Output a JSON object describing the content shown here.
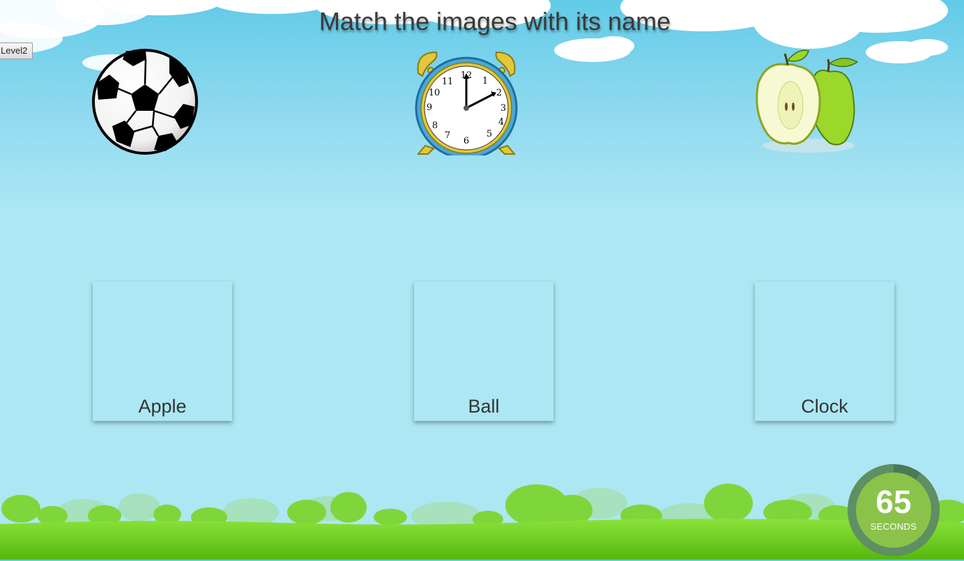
{
  "title": "Match the images with its name",
  "level_button": "Level2",
  "pictures": [
    {
      "name": "soccer-ball",
      "label": "Ball"
    },
    {
      "name": "alarm-clock",
      "label": "Clock"
    },
    {
      "name": "apple",
      "label": "Apple"
    }
  ],
  "clock_face_numbers": [
    "12",
    "1",
    "2",
    "3",
    "4",
    "5",
    "6",
    "7",
    "8",
    "9",
    "10",
    "11"
  ],
  "dropboxes": [
    {
      "label": "Apple"
    },
    {
      "label": "Ball"
    },
    {
      "label": "Clock"
    }
  ],
  "timer": {
    "value": "65",
    "unit": "SECONDS",
    "progress": 0.9
  },
  "colors": {
    "sky_top": "#62cbe8",
    "sky_bottom": "#ace7f3",
    "grass": "#6fcf1f",
    "timer_fill": "#8bc34a",
    "timer_ring": "#4a7a55"
  }
}
